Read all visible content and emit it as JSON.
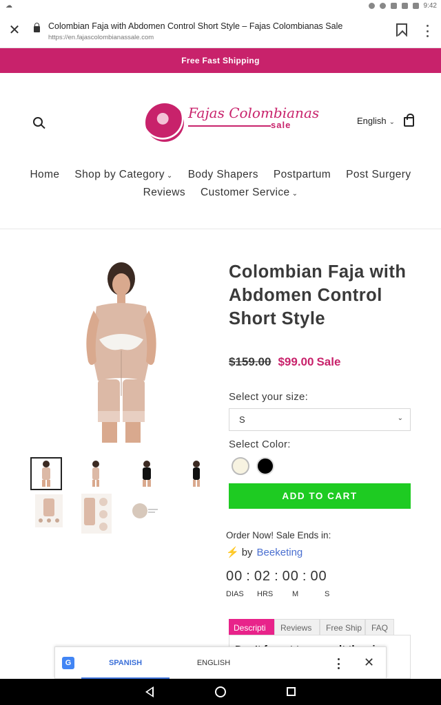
{
  "status_bar": {
    "time": "9:42"
  },
  "browser": {
    "page_title": "Colombian Faja with Abdomen Control Short Style – Fajas Colombianas Sale",
    "url": "https://en.fajascolombianassale.com"
  },
  "promo": {
    "text": "Free Fast Shipping"
  },
  "header": {
    "logo_brand": "Fajas Colombianas",
    "logo_sub": "sale",
    "language": "English"
  },
  "nav": {
    "row1": [
      "Home",
      "Shop by Category",
      "Body Shapers",
      "Postpartum",
      "Post Surgery"
    ],
    "row2": [
      "Reviews",
      "Customer Service"
    ]
  },
  "product": {
    "title": "Colombian Faja with Abdomen Control Short Style",
    "price_old": "$159.00",
    "price_new": "$99.00",
    "sale_label": "Sale",
    "size_label": "Select your size:",
    "size_value": "S",
    "color_label": "Select Color:",
    "colors": [
      "#f7f3e1",
      "#000000"
    ],
    "add_to_cart": "ADD TO CART"
  },
  "countdown": {
    "heading": "Order Now! Sale Ends in:",
    "powered_by": "by",
    "powered_brand": "Beeketing",
    "days": "00",
    "hours": "02",
    "minutes": "00",
    "seconds": "00",
    "labels": [
      "DIAS",
      "HRS",
      "M",
      "S"
    ]
  },
  "tabs": {
    "items": [
      "Descripti",
      "Reviews",
      "Free Ship",
      "FAQ"
    ],
    "content_text": "Don't forget to consult the size"
  },
  "translate": {
    "spanish": "SPANISH",
    "english": "ENGLISH"
  }
}
